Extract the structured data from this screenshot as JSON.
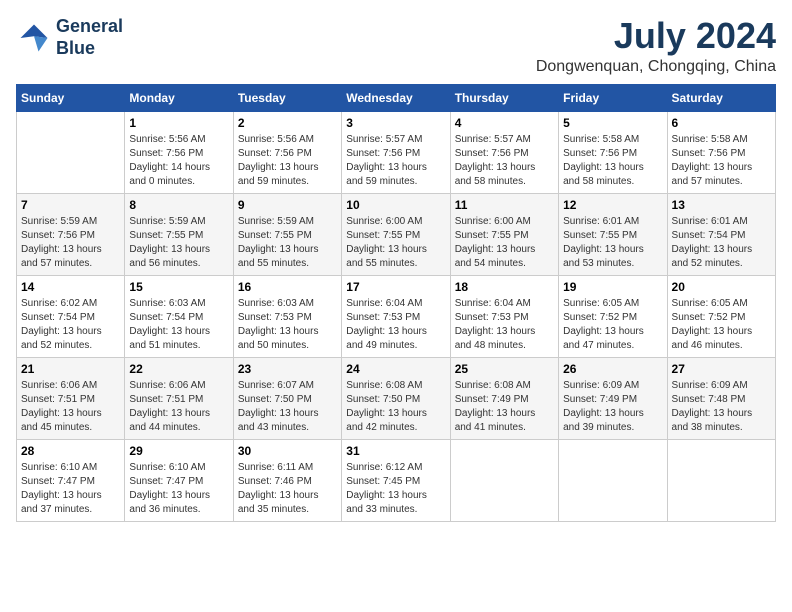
{
  "logo": {
    "line1": "General",
    "line2": "Blue"
  },
  "title": {
    "month_year": "July 2024",
    "location": "Dongwenquan, Chongqing, China"
  },
  "calendar": {
    "headers": [
      "Sunday",
      "Monday",
      "Tuesday",
      "Wednesday",
      "Thursday",
      "Friday",
      "Saturday"
    ],
    "weeks": [
      [
        {
          "day": "",
          "info": ""
        },
        {
          "day": "1",
          "info": "Sunrise: 5:56 AM\nSunset: 7:56 PM\nDaylight: 14 hours\nand 0 minutes."
        },
        {
          "day": "2",
          "info": "Sunrise: 5:56 AM\nSunset: 7:56 PM\nDaylight: 13 hours\nand 59 minutes."
        },
        {
          "day": "3",
          "info": "Sunrise: 5:57 AM\nSunset: 7:56 PM\nDaylight: 13 hours\nand 59 minutes."
        },
        {
          "day": "4",
          "info": "Sunrise: 5:57 AM\nSunset: 7:56 PM\nDaylight: 13 hours\nand 58 minutes."
        },
        {
          "day": "5",
          "info": "Sunrise: 5:58 AM\nSunset: 7:56 PM\nDaylight: 13 hours\nand 58 minutes."
        },
        {
          "day": "6",
          "info": "Sunrise: 5:58 AM\nSunset: 7:56 PM\nDaylight: 13 hours\nand 57 minutes."
        }
      ],
      [
        {
          "day": "7",
          "info": "Sunrise: 5:59 AM\nSunset: 7:56 PM\nDaylight: 13 hours\nand 57 minutes."
        },
        {
          "day": "8",
          "info": "Sunrise: 5:59 AM\nSunset: 7:55 PM\nDaylight: 13 hours\nand 56 minutes."
        },
        {
          "day": "9",
          "info": "Sunrise: 5:59 AM\nSunset: 7:55 PM\nDaylight: 13 hours\nand 55 minutes."
        },
        {
          "day": "10",
          "info": "Sunrise: 6:00 AM\nSunset: 7:55 PM\nDaylight: 13 hours\nand 55 minutes."
        },
        {
          "day": "11",
          "info": "Sunrise: 6:00 AM\nSunset: 7:55 PM\nDaylight: 13 hours\nand 54 minutes."
        },
        {
          "day": "12",
          "info": "Sunrise: 6:01 AM\nSunset: 7:55 PM\nDaylight: 13 hours\nand 53 minutes."
        },
        {
          "day": "13",
          "info": "Sunrise: 6:01 AM\nSunset: 7:54 PM\nDaylight: 13 hours\nand 52 minutes."
        }
      ],
      [
        {
          "day": "14",
          "info": "Sunrise: 6:02 AM\nSunset: 7:54 PM\nDaylight: 13 hours\nand 52 minutes."
        },
        {
          "day": "15",
          "info": "Sunrise: 6:03 AM\nSunset: 7:54 PM\nDaylight: 13 hours\nand 51 minutes."
        },
        {
          "day": "16",
          "info": "Sunrise: 6:03 AM\nSunset: 7:53 PM\nDaylight: 13 hours\nand 50 minutes."
        },
        {
          "day": "17",
          "info": "Sunrise: 6:04 AM\nSunset: 7:53 PM\nDaylight: 13 hours\nand 49 minutes."
        },
        {
          "day": "18",
          "info": "Sunrise: 6:04 AM\nSunset: 7:53 PM\nDaylight: 13 hours\nand 48 minutes."
        },
        {
          "day": "19",
          "info": "Sunrise: 6:05 AM\nSunset: 7:52 PM\nDaylight: 13 hours\nand 47 minutes."
        },
        {
          "day": "20",
          "info": "Sunrise: 6:05 AM\nSunset: 7:52 PM\nDaylight: 13 hours\nand 46 minutes."
        }
      ],
      [
        {
          "day": "21",
          "info": "Sunrise: 6:06 AM\nSunset: 7:51 PM\nDaylight: 13 hours\nand 45 minutes."
        },
        {
          "day": "22",
          "info": "Sunrise: 6:06 AM\nSunset: 7:51 PM\nDaylight: 13 hours\nand 44 minutes."
        },
        {
          "day": "23",
          "info": "Sunrise: 6:07 AM\nSunset: 7:50 PM\nDaylight: 13 hours\nand 43 minutes."
        },
        {
          "day": "24",
          "info": "Sunrise: 6:08 AM\nSunset: 7:50 PM\nDaylight: 13 hours\nand 42 minutes."
        },
        {
          "day": "25",
          "info": "Sunrise: 6:08 AM\nSunset: 7:49 PM\nDaylight: 13 hours\nand 41 minutes."
        },
        {
          "day": "26",
          "info": "Sunrise: 6:09 AM\nSunset: 7:49 PM\nDaylight: 13 hours\nand 39 minutes."
        },
        {
          "day": "27",
          "info": "Sunrise: 6:09 AM\nSunset: 7:48 PM\nDaylight: 13 hours\nand 38 minutes."
        }
      ],
      [
        {
          "day": "28",
          "info": "Sunrise: 6:10 AM\nSunset: 7:47 PM\nDaylight: 13 hours\nand 37 minutes."
        },
        {
          "day": "29",
          "info": "Sunrise: 6:10 AM\nSunset: 7:47 PM\nDaylight: 13 hours\nand 36 minutes."
        },
        {
          "day": "30",
          "info": "Sunrise: 6:11 AM\nSunset: 7:46 PM\nDaylight: 13 hours\nand 35 minutes."
        },
        {
          "day": "31",
          "info": "Sunrise: 6:12 AM\nSunset: 7:45 PM\nDaylight: 13 hours\nand 33 minutes."
        },
        {
          "day": "",
          "info": ""
        },
        {
          "day": "",
          "info": ""
        },
        {
          "day": "",
          "info": ""
        }
      ]
    ]
  }
}
